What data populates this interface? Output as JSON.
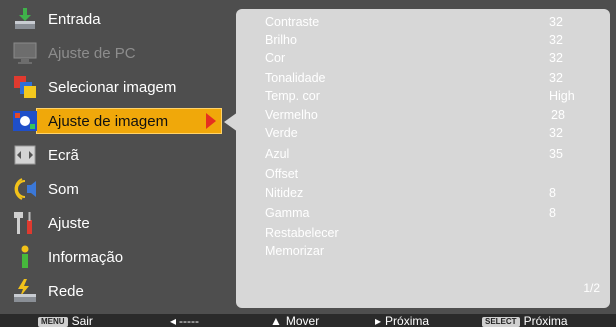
{
  "menu": {
    "items": [
      {
        "label": "Entrada",
        "icon": "input-icon",
        "state": "normal"
      },
      {
        "label": "Ajuste de PC",
        "icon": "pc-adjust-icon",
        "state": "disabled"
      },
      {
        "label": "Selecionar imagem",
        "icon": "image-select-icon",
        "state": "normal"
      },
      {
        "label": "Ajuste de imagem",
        "icon": "image-adjust-icon",
        "state": "active"
      },
      {
        "label": "Ecrã",
        "icon": "screen-icon",
        "state": "normal"
      },
      {
        "label": "Som",
        "icon": "sound-icon",
        "state": "normal"
      },
      {
        "label": "Ajuste",
        "icon": "setting-icon",
        "state": "normal"
      },
      {
        "label": "Informação",
        "icon": "information-icon",
        "state": "normal"
      },
      {
        "label": "Rede",
        "icon": "network-icon",
        "state": "normal"
      }
    ]
  },
  "panel": {
    "rows": [
      {
        "name": "Contraste",
        "value": "32"
      },
      {
        "name": "Brilho",
        "value": "32"
      },
      {
        "name": "Cor",
        "value": "32"
      },
      {
        "name": "Tonalidade",
        "value": "32"
      },
      {
        "name": "Temp. cor",
        "value": "High"
      },
      {
        "name": "Vermelho",
        "value": "28"
      },
      {
        "name": "Verde",
        "value": "32"
      },
      {
        "name": "Azul",
        "value": "35"
      },
      {
        "name": "Offset",
        "value": ""
      },
      {
        "name": "Nitidez",
        "value": "8"
      },
      {
        "name": "Gamma",
        "value": "8"
      },
      {
        "name": "Restabelecer",
        "value": ""
      },
      {
        "name": "Memorizar",
        "value": ""
      }
    ],
    "page_indicator": "1/2"
  },
  "footer": {
    "menu_key": "MENU",
    "exit_label": "Sair",
    "back_label": "-----",
    "move_label": "Mover",
    "next_label": "Próxima",
    "select_key": "SELECT",
    "select_label": "Próxima"
  },
  "colors": {
    "background": "#4e4e4e",
    "panel": "#d7d7d7",
    "highlight": "#f0a80a",
    "arrow": "#e53020"
  }
}
